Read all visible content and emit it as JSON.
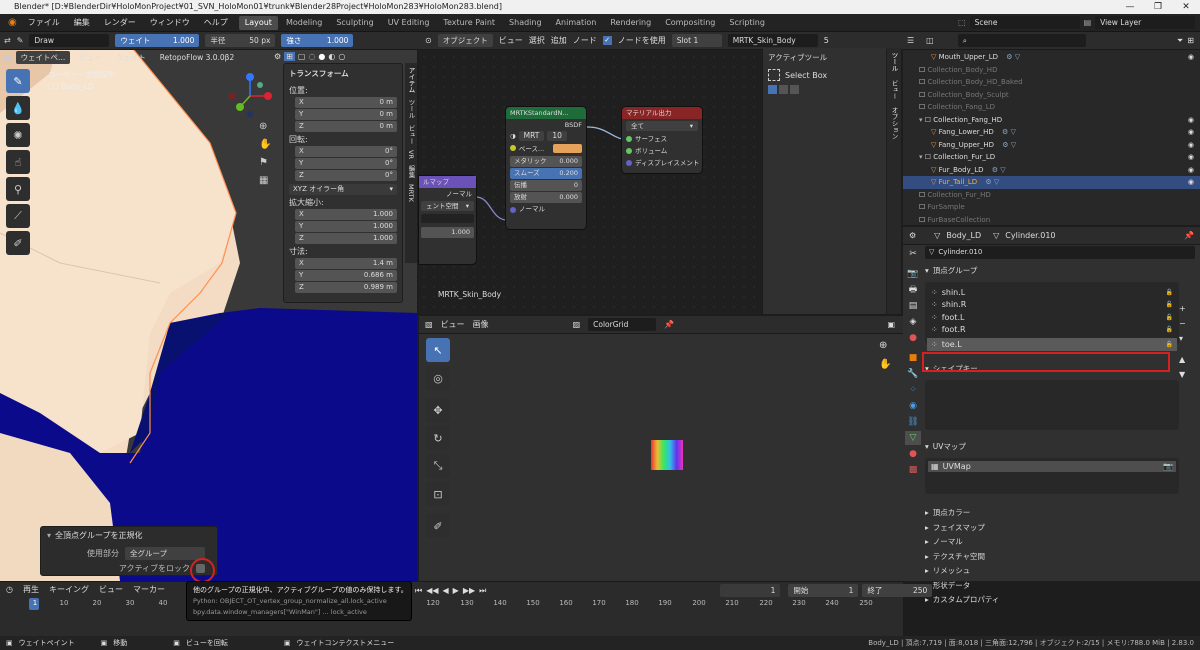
{
  "title": "Blender* [D:¥BlenderDir¥HoloMonProject¥01_SVN_HoloMon01¥trunk¥Blender28Project¥HoloMon283¥HoloMon283.blend]",
  "menus": [
    "ファイル",
    "編集",
    "レンダー",
    "ウィンドウ",
    "ヘルプ"
  ],
  "workspaces": [
    "Layout",
    "Modeling",
    "Sculpting",
    "UV Editing",
    "Texture Paint",
    "Shading",
    "Animation",
    "Rendering",
    "Compositing",
    "Scripting"
  ],
  "scene": "Scene",
  "view_layer": "View Layer",
  "tool_header": {
    "brush": "Draw",
    "weight_label": "ウェイト",
    "weight_val": "1.000",
    "radius_label": "半径",
    "radius_val": "50 px",
    "strength_label": "強さ",
    "strength_val": "1.000"
  },
  "viewport": {
    "mode": "ウェイトペ...",
    "view": "ビュー",
    "weight_menu": "ウェイト",
    "addon": "RetopoFlow 3.0.0β2",
    "overlay1": "ユーザー・透視投影",
    "overlay2": "(1) Body_LD"
  },
  "transform": {
    "title": "トランスフォーム",
    "location": "位置:",
    "rotation": "回転:",
    "scale": "拡大縮小:",
    "dimensions": "寸法:",
    "rot_mode": "XYZ オイラー角",
    "axes": [
      "X",
      "Y",
      "Z"
    ],
    "loc_vals": [
      "0 m",
      "0 m",
      "0 m"
    ],
    "rot_vals": [
      "0°",
      "0°",
      "0°"
    ],
    "scale_vals": [
      "1.000",
      "1.000",
      "1.000"
    ],
    "dim_vals": [
      "1.4 m",
      "0.686 m",
      "0.989 m"
    ]
  },
  "side_tabs": [
    "アイテム",
    "ツール",
    "ビュー",
    "VR",
    "編集",
    "MRTK"
  ],
  "op_panel": {
    "title": "全頂点グループを正規化",
    "subset_label": "使用部分",
    "subset_val": "全グループ",
    "lock_label": "アクティブをロック"
  },
  "tooltip": {
    "line1": "他のグループの正規化中、アクティブグループの値のみ保持します。",
    "line2": "Python: OBJECT_OT_vertex_group_normalize_all.lock_active",
    "line3": "bpy.data.window_managers[\"WinMan\"] ... lock_active"
  },
  "node_header": {
    "object": "オブジェクト",
    "view": "ビュー",
    "select": "選択",
    "add": "追加",
    "node": "ノード",
    "use_nodes": "ノードを使用",
    "slot": "Slot 1",
    "material": "MRTK_Skin_Body",
    "users": "5"
  },
  "node_mrtk": {
    "title": "MRTKStandardN...",
    "bsdf": "BSDF",
    "mrt": "MRT",
    "num": "10",
    "base": "ベース...",
    "metallic": "メタリック",
    "metallic_val": "0.000",
    "smooth": "スムーズ",
    "smooth_val": "0.200",
    "transmission": "伝播",
    "transmission_val": "0",
    "emission": "放射",
    "emission_val": "0.000",
    "normal": "ノーマル"
  },
  "node_output": {
    "title": "マテリアル出力",
    "target": "全て",
    "surface": "サーフェス",
    "volume": "ボリューム",
    "displacement": "ディスプレイスメント"
  },
  "node_normalmap": {
    "title": "ルマップ",
    "normal": "ノーマル",
    "space": "ェント空間",
    "strength": "1.000"
  },
  "node_label": "MRTK_Skin_Body",
  "node_sidebar": {
    "title": "アクティブツール",
    "select_box": "Select Box",
    "tabs": [
      "ツール",
      "ビュー",
      "オプション"
    ]
  },
  "image_editor": {
    "view": "ビュー",
    "image": "画像",
    "name": "ColorGrid"
  },
  "outliner": {
    "rows": [
      {
        "name": "Mouth_Upper_LD",
        "indent": 2,
        "dim": false,
        "sel": false
      },
      {
        "name": "Collection_Body_HD",
        "indent": 1,
        "dim": true,
        "sel": false
      },
      {
        "name": "Collection_Body_HD_Baked",
        "indent": 1,
        "dim": true,
        "sel": false
      },
      {
        "name": "Collection_Body_Sculpt",
        "indent": 1,
        "dim": true,
        "sel": false
      },
      {
        "name": "Collection_Fang_LD",
        "indent": 1,
        "dim": true,
        "sel": false
      },
      {
        "name": "Collection_Fang_HD",
        "indent": 1,
        "dim": false,
        "sel": false
      },
      {
        "name": "Fang_Lower_HD",
        "indent": 2,
        "dim": false,
        "sel": false
      },
      {
        "name": "Fang_Upper_HD",
        "indent": 2,
        "dim": false,
        "sel": false
      },
      {
        "name": "Collection_Fur_LD",
        "indent": 1,
        "dim": false,
        "sel": false
      },
      {
        "name": "Fur_Body_LD",
        "indent": 2,
        "dim": false,
        "sel": false
      },
      {
        "name": "Fur_Tail_LD",
        "indent": 2,
        "dim": false,
        "sel": true
      },
      {
        "name": "Collection_Fur_HD",
        "indent": 1,
        "dim": true,
        "sel": false
      },
      {
        "name": "FurSample",
        "indent": 1,
        "dim": true,
        "sel": false
      },
      {
        "name": "FurBaseCollection",
        "indent": 1,
        "dim": true,
        "sel": false
      }
    ]
  },
  "props": {
    "obj": "Body_LD",
    "mesh": "Cylinder.010",
    "datablock": "Cylinder.010",
    "vg_title": "頂点グループ",
    "vgroups": [
      "shin.L",
      "shin.R",
      "foot.L",
      "foot.R",
      "toe.L"
    ],
    "shape_title": "シェイプキー",
    "uv_title": "UVマップ",
    "uvmap": "UVMap",
    "collapsed": [
      "頂点カラー",
      "フェイスマップ",
      "ノーマル",
      "テクスチャ空間",
      "リメッシュ",
      "形状データ",
      "カスタムプロパティ"
    ]
  },
  "timeline": {
    "play": "再生",
    "keying": "キーイング",
    "view": "ビュー",
    "marker": "マーカー",
    "frame": "1",
    "start_label": "開始",
    "start": "1",
    "end_label": "終了",
    "end": "250",
    "ticks": [
      "1",
      "10",
      "20",
      "30",
      "40",
      "120",
      "130",
      "140",
      "150",
      "160",
      "170",
      "180",
      "190",
      "200",
      "210",
      "220",
      "230",
      "240",
      "250"
    ]
  },
  "status": {
    "left1": "ウェイトペイント",
    "left2": "移動",
    "left3": "ビューを回転",
    "left4": "ウェイトコンテクストメニュー",
    "right": "Body_LD | 頂点:7,719 | 面:8,018 | 三角面:12,796 | オブジェクト:2/15 | メモリ:788.0 MiB | 2.83.0"
  },
  "colors": {
    "accent": "#4772b3",
    "highlight": "#d92020",
    "skin": "#f4dcc4",
    "navy": "#0a0a8a"
  }
}
